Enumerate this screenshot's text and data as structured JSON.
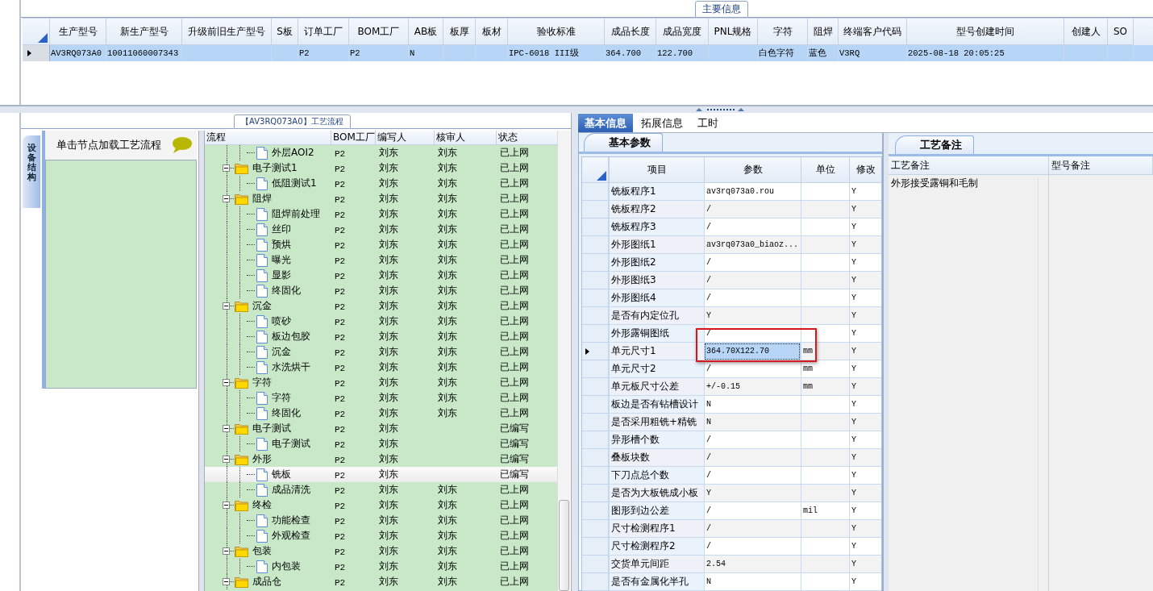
{
  "main_info": {
    "title": "主要信息",
    "columns": [
      "生产型号",
      "新生产型号",
      "升级前旧生产型号",
      "S板",
      "订单工厂",
      "BOM工厂",
      "AB板",
      "板厚",
      "板材",
      "验收标准",
      "成品长度",
      "成品宽度",
      "PNL规格",
      "字符",
      "阻焊",
      "终端客户代码",
      "型号创建时间",
      "创建人",
      "SO"
    ],
    "rows": [
      {
        "selected": true,
        "cells": [
          "AV3RQ073A0",
          "10011060007343",
          null,
          null,
          "P2",
          "P2",
          "N",
          null,
          null,
          "IPC-6018 III级",
          "364.700",
          "122.700",
          null,
          "白色字符",
          "蓝色",
          "V3RQ",
          "2025-08-18 20:05:25",
          null,
          null
        ]
      }
    ]
  },
  "process_flow": {
    "title": "【AV3RQ073A0】工艺流程",
    "side_tab": "设备结构",
    "hint": "单击节点加载工艺流程",
    "columns": [
      "流程",
      "BOM工厂",
      "编写人",
      "核审人",
      "状态"
    ],
    "nodes": [
      {
        "kind": "step",
        "name": "外层AOI2",
        "bom": "P2",
        "writer": "刘东",
        "reviewer": "刘东",
        "status": "已上网",
        "selected": false
      },
      {
        "kind": "group",
        "name": "电子测试1",
        "bom": "P2",
        "writer": "刘东",
        "reviewer": "刘东",
        "status": "已上网",
        "selected": false,
        "expanded": true,
        "children": [
          {
            "kind": "step",
            "name": "低阻测试1",
            "bom": "P2",
            "writer": "刘东",
            "reviewer": "刘东",
            "status": "已上网",
            "selected": false
          }
        ]
      },
      {
        "kind": "group",
        "name": "阻焊",
        "bom": "P2",
        "writer": "刘东",
        "reviewer": "刘东",
        "status": "已上网",
        "selected": false,
        "expanded": true,
        "children": [
          {
            "kind": "step",
            "name": "阻焊前处理",
            "bom": "P2",
            "writer": "刘东",
            "reviewer": "刘东",
            "status": "已上网",
            "selected": false
          },
          {
            "kind": "step",
            "name": "丝印",
            "bom": "P2",
            "writer": "刘东",
            "reviewer": "刘东",
            "status": "已上网",
            "selected": false
          },
          {
            "kind": "step",
            "name": "预烘",
            "bom": "P2",
            "writer": "刘东",
            "reviewer": "刘东",
            "status": "已上网",
            "selected": false
          },
          {
            "kind": "step",
            "name": "曝光",
            "bom": "P2",
            "writer": "刘东",
            "reviewer": "刘东",
            "status": "已上网",
            "selected": false
          },
          {
            "kind": "step",
            "name": "显影",
            "bom": "P2",
            "writer": "刘东",
            "reviewer": "刘东",
            "status": "已上网",
            "selected": false
          },
          {
            "kind": "step",
            "name": "终固化",
            "bom": "P2",
            "writer": "刘东",
            "reviewer": "刘东",
            "status": "已上网",
            "selected": false
          }
        ]
      },
      {
        "kind": "group",
        "name": "沉金",
        "bom": "P2",
        "writer": "刘东",
        "reviewer": "刘东",
        "status": "已上网",
        "selected": false,
        "expanded": true,
        "children": [
          {
            "kind": "step",
            "name": "喷砂",
            "bom": "P2",
            "writer": "刘东",
            "reviewer": "刘东",
            "status": "已上网",
            "selected": false
          },
          {
            "kind": "step",
            "name": "板边包胶",
            "bom": "P2",
            "writer": "刘东",
            "reviewer": "刘东",
            "status": "已上网",
            "selected": false
          },
          {
            "kind": "step",
            "name": "沉金",
            "bom": "P2",
            "writer": "刘东",
            "reviewer": "刘东",
            "status": "已上网",
            "selected": false
          },
          {
            "kind": "step",
            "name": "水洗烘干",
            "bom": "P2",
            "writer": "刘东",
            "reviewer": "刘东",
            "status": "已上网",
            "selected": false
          }
        ]
      },
      {
        "kind": "group",
        "name": "字符",
        "bom": "P2",
        "writer": "刘东",
        "reviewer": "刘东",
        "status": "已上网",
        "selected": false,
        "expanded": true,
        "children": [
          {
            "kind": "step",
            "name": "字符",
            "bom": "P2",
            "writer": "刘东",
            "reviewer": "刘东",
            "status": "已上网",
            "selected": false
          },
          {
            "kind": "step",
            "name": "终固化",
            "bom": "P2",
            "writer": "刘东",
            "reviewer": "刘东",
            "status": "已上网",
            "selected": false
          }
        ]
      },
      {
        "kind": "group",
        "name": "电子测试",
        "bom": "P2",
        "writer": "刘东",
        "status": "已编写",
        "selected": false,
        "expanded": true,
        "children": [
          {
            "kind": "step",
            "name": "电子测试",
            "bom": "P2",
            "writer": "刘东",
            "status": "已编写",
            "selected": false
          }
        ]
      },
      {
        "kind": "group",
        "name": "外形",
        "bom": "P2",
        "writer": "刘东",
        "status": "已编写",
        "selected": false,
        "expanded": true,
        "children": [
          {
            "kind": "step",
            "name": "铣板",
            "bom": "P2",
            "writer": "刘东",
            "status": "已编写",
            "selected": true
          },
          {
            "kind": "step",
            "name": "成品清洗",
            "bom": "P2",
            "writer": "刘东",
            "reviewer": "刘东",
            "status": "已上网",
            "selected": false
          }
        ]
      },
      {
        "kind": "group",
        "name": "终检",
        "bom": "P2",
        "writer": "刘东",
        "reviewer": "刘东",
        "status": "已上网",
        "selected": false,
        "expanded": true,
        "children": [
          {
            "kind": "step",
            "name": "功能检查",
            "bom": "P2",
            "writer": "刘东",
            "reviewer": "刘东",
            "status": "已上网",
            "selected": false
          },
          {
            "kind": "step",
            "name": "外观检查",
            "bom": "P2",
            "writer": "刘东",
            "reviewer": "刘东",
            "status": "已上网",
            "selected": false
          }
        ]
      },
      {
        "kind": "group",
        "name": "包装",
        "bom": "P2",
        "writer": "刘东",
        "reviewer": "刘东",
        "status": "已上网",
        "selected": false,
        "expanded": true,
        "children": [
          {
            "kind": "step",
            "name": "内包装",
            "bom": "P2",
            "writer": "刘东",
            "reviewer": "刘东",
            "status": "已上网",
            "selected": false
          }
        ]
      },
      {
        "kind": "group",
        "name": "成品仓",
        "bom": "P2",
        "writer": "刘东",
        "reviewer": "刘东",
        "status": "已上网",
        "selected": false,
        "expanded": true
      }
    ]
  },
  "detail_tabs": [
    {
      "label": "基本信息",
      "selected": true
    },
    {
      "label": "拓展信息",
      "selected": false
    },
    {
      "label": "工时",
      "selected": false
    }
  ],
  "basic_params": {
    "tab": "基本参数",
    "columns": [
      "项目",
      "参数",
      "单位",
      "修改"
    ],
    "rows": [
      {
        "item": "铣板程序1",
        "value": "av3rq073a0.rou",
        "modified": "Y",
        "current": false,
        "highlighted": false
      },
      {
        "item": "铣板程序2",
        "value": "/",
        "modified": "Y",
        "current": false,
        "highlighted": false
      },
      {
        "item": "铣板程序3",
        "value": "/",
        "modified": "Y",
        "current": false,
        "highlighted": false
      },
      {
        "item": "外形图纸1",
        "value": "av3rq073a0_biaoz...",
        "modified": "Y",
        "current": false,
        "highlighted": false
      },
      {
        "item": "外形图纸2",
        "value": "/",
        "modified": "Y",
        "current": false,
        "highlighted": false
      },
      {
        "item": "外形图纸3",
        "value": "/",
        "modified": "Y",
        "current": false,
        "highlighted": false
      },
      {
        "item": "外形图纸4",
        "value": "/",
        "modified": "Y",
        "current": false,
        "highlighted": false
      },
      {
        "item": "是否有内定位孔",
        "value": "Y",
        "modified": "Y",
        "current": false,
        "highlighted": false
      },
      {
        "item": "外形露铜图纸",
        "value": "/",
        "modified": "Y",
        "current": false,
        "highlighted": false
      },
      {
        "item": "单元尺寸1",
        "value": "364.70X122.70",
        "unit": "mm",
        "modified": "Y",
        "current": true,
        "highlighted": true
      },
      {
        "item": "单元尺寸2",
        "value": "/",
        "unit": "mm",
        "modified": "Y",
        "current": false,
        "highlighted": false
      },
      {
        "item": "单元板尺寸公差",
        "value": "+/-0.15",
        "unit": "mm",
        "modified": "Y",
        "current": false,
        "highlighted": false
      },
      {
        "item": "板边是否有钻槽设计",
        "value": "N",
        "modified": "Y",
        "current": false,
        "highlighted": false
      },
      {
        "item": "是否采用粗铣+精铣",
        "value": "N",
        "modified": "Y",
        "current": false,
        "highlighted": false
      },
      {
        "item": "异形槽个数",
        "value": "/",
        "modified": "Y",
        "current": false,
        "highlighted": false
      },
      {
        "item": "叠板块数",
        "value": "/",
        "modified": "Y",
        "current": false,
        "highlighted": false
      },
      {
        "item": "下刀点总个数",
        "value": "/",
        "modified": "Y",
        "current": false,
        "highlighted": false
      },
      {
        "item": "是否为大板铣成小板",
        "value": "Y",
        "modified": "Y",
        "current": false,
        "highlighted": false
      },
      {
        "item": "图形到边公差",
        "value": "/",
        "unit": "mil",
        "modified": "Y",
        "current": false,
        "highlighted": false
      },
      {
        "item": "尺寸检测程序1",
        "value": "/",
        "modified": "Y",
        "current": false,
        "highlighted": false
      },
      {
        "item": "尺寸检测程序2",
        "value": "/",
        "modified": "Y",
        "current": false,
        "highlighted": false
      },
      {
        "item": "交货单元间距",
        "value": "2.54",
        "modified": "Y",
        "current": false,
        "highlighted": false
      },
      {
        "item": "是否有金属化半孔",
        "value": "N",
        "modified": "Y",
        "current": false,
        "highlighted": false
      }
    ]
  },
  "notes": {
    "tab": "工艺备注",
    "columns": [
      "工艺备注",
      "型号备注"
    ],
    "rows": [
      {
        "process_note": "外形接受露铜和毛制"
      }
    ]
  }
}
